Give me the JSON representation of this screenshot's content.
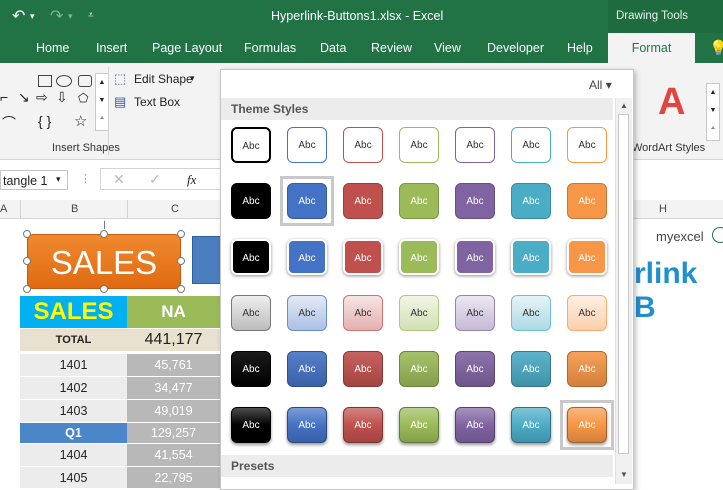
{
  "window": {
    "title": "Hyperlink-Buttons1.xlsx  -  Excel",
    "context_tab_group": "Drawing Tools"
  },
  "ribbon_tabs": [
    "Home",
    "Insert",
    "Page Layout",
    "Formulas",
    "Data",
    "Review",
    "View",
    "Developer",
    "Help"
  ],
  "active_tab": "Format",
  "ribbon": {
    "edit_shape": "Edit Shape",
    "text_box": "Text Box",
    "insert_shapes_label": "Insert Shapes",
    "wordart_label": "WordArt Styles",
    "wordart_letter": "A"
  },
  "formula_bar": {
    "name_box": "tangle 1",
    "fx": "fx"
  },
  "columns": [
    "A",
    "B",
    "C",
    "H"
  ],
  "sheet": {
    "sales_button": "SALES",
    "header_left": "SALES",
    "header_right": "NA",
    "total_label": "TOTAL",
    "total_value": "441,177",
    "rows": [
      {
        "label": "1401",
        "value": "45,761"
      },
      {
        "label": "1402",
        "value": "34,477"
      },
      {
        "label": "1403",
        "value": "49,019"
      },
      {
        "label": "Q1",
        "value": "129,257"
      },
      {
        "label": "1404",
        "value": "41,554"
      },
      {
        "label": "1405",
        "value": "22,795"
      }
    ],
    "logo_text": "myexcel",
    "banner_text": "rlink B"
  },
  "gallery": {
    "filter": "All",
    "theme_heading": "Theme Styles",
    "presets_heading": "Presets",
    "swatch_label": "Abc",
    "colors": [
      "#000000",
      "#4472c4",
      "#c0504d",
      "#9bbb59",
      "#8064a2",
      "#4bacc6",
      "#f79646"
    ]
  }
}
